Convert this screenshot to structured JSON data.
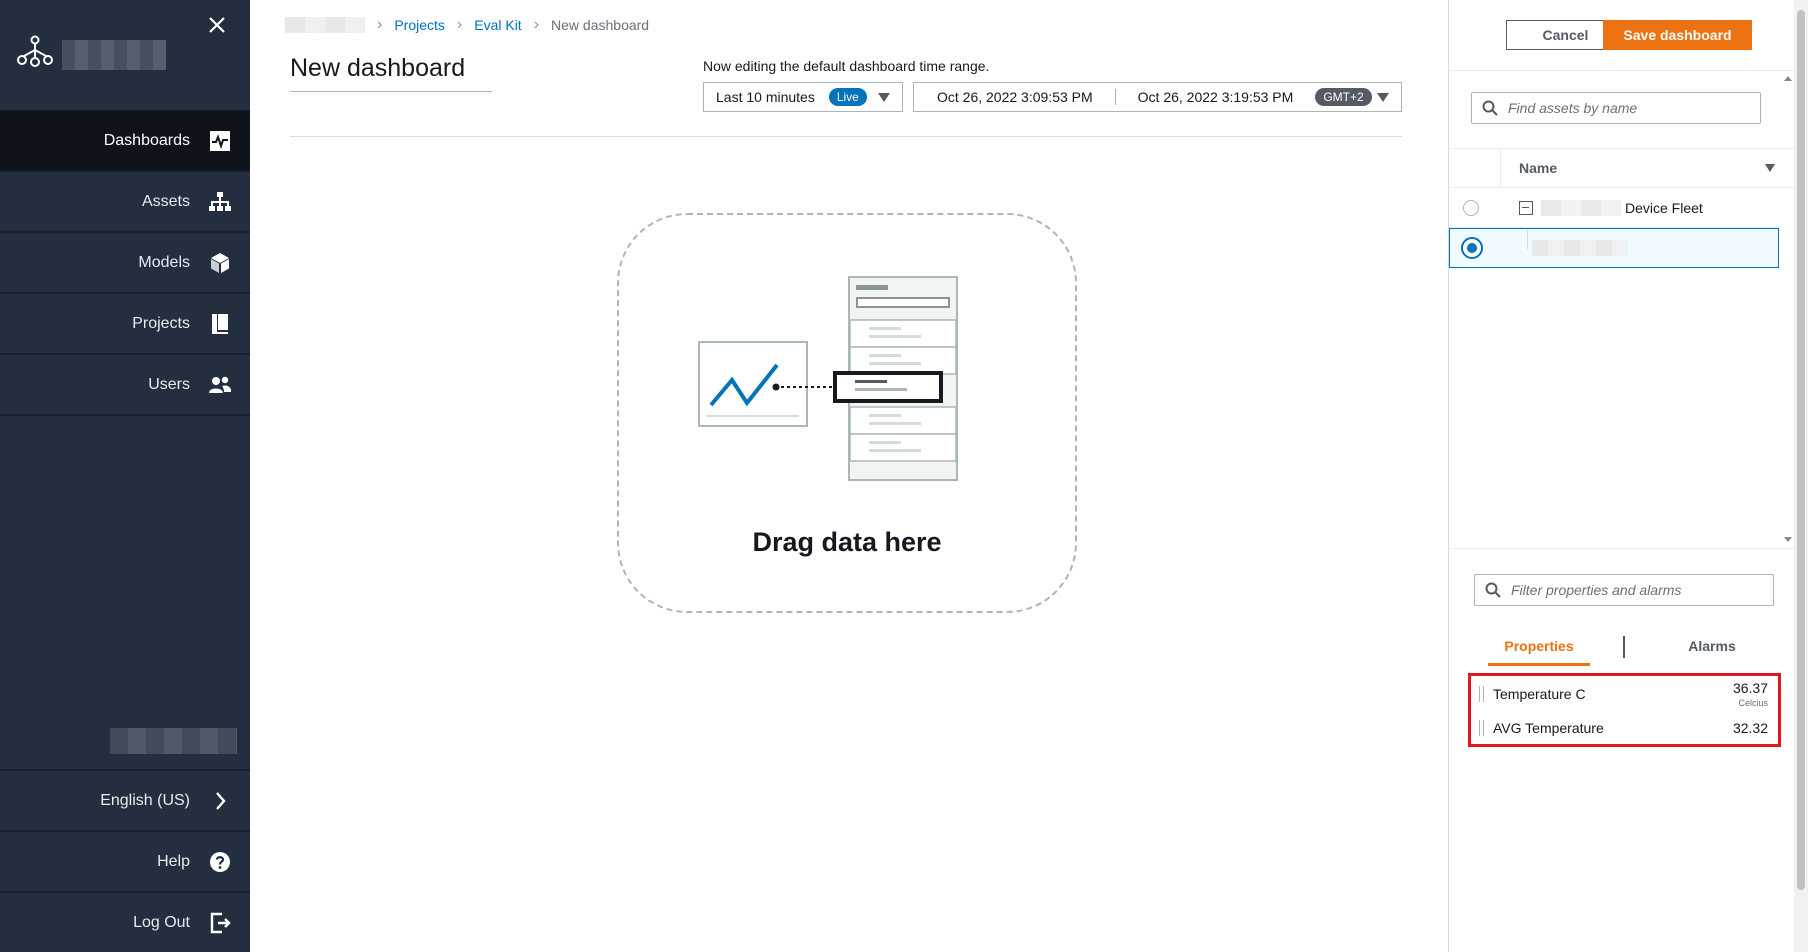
{
  "sidebar": {
    "items": [
      {
        "label": "Dashboards",
        "icon": "dashboard-pulse-icon"
      },
      {
        "label": "Assets",
        "icon": "hierarchy-icon"
      },
      {
        "label": "Models",
        "icon": "cube-icon"
      },
      {
        "label": "Projects",
        "icon": "book-icon"
      },
      {
        "label": "Users",
        "icon": "users-icon"
      }
    ],
    "bottom": {
      "language": "English (US)",
      "help": "Help",
      "logout": "Log Out"
    }
  },
  "breadcrumb": {
    "projects": "Projects",
    "eval_kit": "Eval Kit",
    "current": "New dashboard"
  },
  "page": {
    "title": "New dashboard",
    "time_note": "Now editing the default dashboard time range.",
    "range_label": "Last 10 minutes",
    "live_badge": "Live",
    "start_time": "Oct 26, 2022 3:09:53 PM",
    "end_time": "Oct 26, 2022 3:19:53 PM",
    "timezone": "GMT+2",
    "dropzone_text": "Drag data here"
  },
  "panel": {
    "cancel": "Cancel",
    "save": "Save dashboard",
    "search_placeholder": "Find assets by name",
    "name_header": "Name",
    "asset_device_fleet": "Device Fleet",
    "filter_placeholder": "Filter properties and alarms",
    "tab_properties": "Properties",
    "tab_alarms": "Alarms",
    "properties": [
      {
        "name": "Temperature C",
        "value": "36.37",
        "unit": "Celcius"
      },
      {
        "name": "AVG Temperature",
        "value": "32.32",
        "unit": ""
      }
    ]
  },
  "colors": {
    "sidebar": "#232f3e",
    "accent_orange": "#ec7211",
    "link_blue": "#0073bb",
    "highlight_red": "#e01722"
  }
}
